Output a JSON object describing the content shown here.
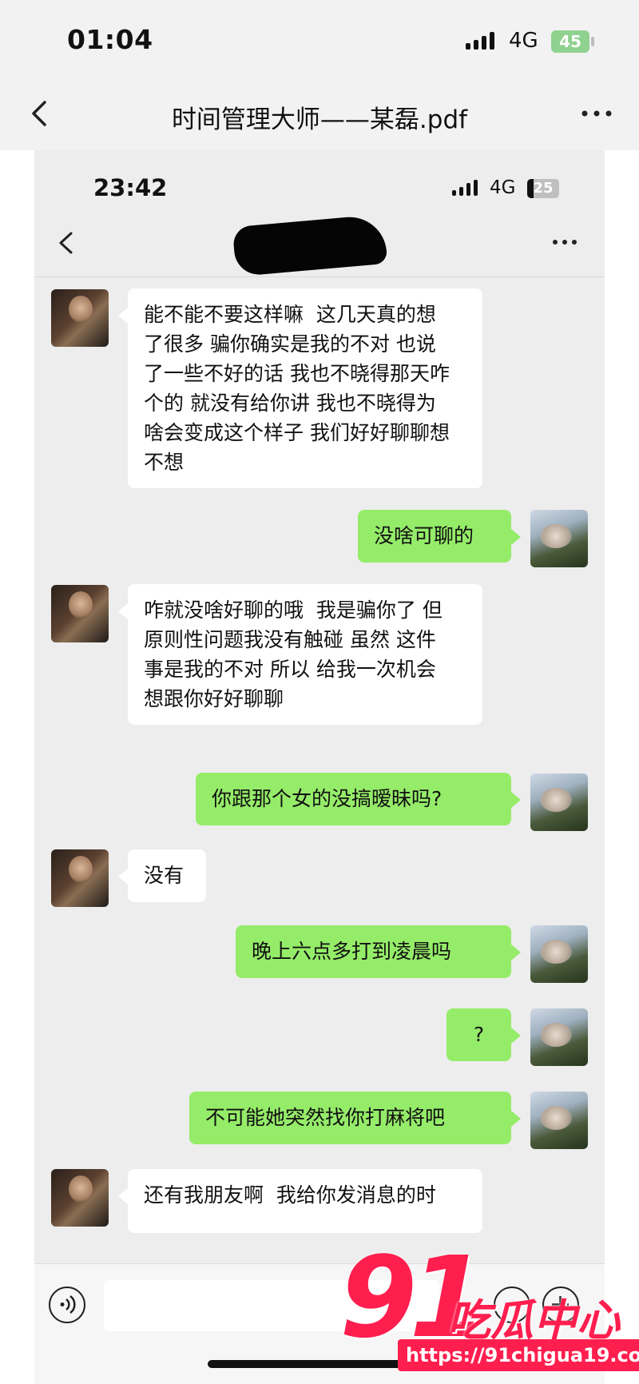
{
  "outer_status": {
    "time": "01:04",
    "network": "4G",
    "battery": "45"
  },
  "outer_nav": {
    "title": "时间管理大师——某磊.pdf"
  },
  "inner_status": {
    "time": "23:42",
    "network": "4G",
    "battery": "25"
  },
  "messages": [
    {
      "side": "left",
      "text": "能不能不要这样嘛  这几天真的想\n了很多 骗你确实是我的不对 也说\n了一些不好的话 我也不晓得那天咋\n个的 就没有给你讲 我也不晓得为\n啥会变成这个样子 我们好好聊聊想\n不想"
    },
    {
      "side": "right",
      "text": "没啥可聊的"
    },
    {
      "side": "left",
      "text": "咋就没啥好聊的哦  我是骗你了 但\n原则性问题我没有触碰 虽然 这件\n事是我的不对 所以 给我一次机会\n想跟你好好聊聊"
    },
    {
      "side": "right",
      "text": "你跟那个女的没搞暧昧吗?"
    },
    {
      "side": "left",
      "text": "没有"
    },
    {
      "side": "right",
      "text": "晚上六点多打到凌晨吗"
    },
    {
      "side": "right",
      "text": "?"
    },
    {
      "side": "right",
      "text": "不可能她突然找你打麻将吧"
    },
    {
      "side": "left",
      "text": "还有我朋友啊  我给你发消息的时"
    }
  ],
  "watermark": {
    "number": "91",
    "brand": "吃瓜中心",
    "url": "https://91chigua19.com"
  },
  "colors": {
    "self_bubble": "#95ec69",
    "other_bubble": "#ffffff",
    "watermark": "#ff1f4f"
  }
}
